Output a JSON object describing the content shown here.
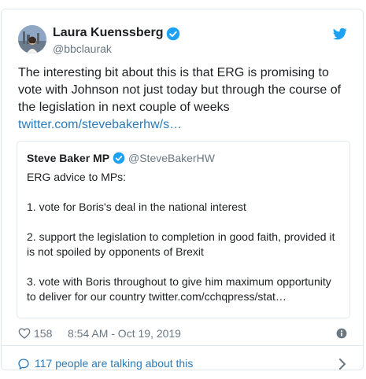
{
  "tweet": {
    "author_name": "Laura Kuenssberg",
    "author_handle": "@bbclaurak",
    "text": "The interesting bit about this is that ERG is promising to vote with Johnson not just today but through the course of the legislation in next couple of weeks",
    "link": "twitter.com/stevebakerhw/s…",
    "likes": "158",
    "timestamp": "8:54 AM - Oct 19, 2019",
    "talking": "117 people are talking about this"
  },
  "quoted": {
    "author_name": "Steve Baker MP",
    "author_handle": "@SteveBakerHW",
    "line1": "ERG advice to MPs:",
    "line2": "1. vote for Boris's deal in the national interest",
    "line3": "2. support the legislation to completion in good faith, provided it is not spoiled by opponents of Brexit",
    "line4": "3. vote with Boris throughout to give him maximum opportunity to deliver for our country twitter.com/cchqpress/stat…"
  },
  "colors": {
    "accent": "#1da1f2",
    "link": "#2b7bb9",
    "muted": "#697882",
    "border": "#e1e8ed"
  },
  "icons": [
    "verified-icon",
    "twitter-bird-icon",
    "heart-icon",
    "info-icon",
    "comment-icon",
    "chevron-right-icon"
  ]
}
